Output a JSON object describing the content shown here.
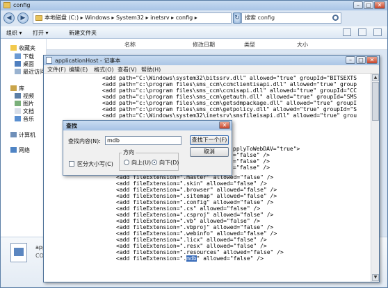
{
  "explorer": {
    "title": "config",
    "address": "本地磁盘 (C:) ▸ Windows ▸ System32 ▸ inetsrv ▸ config ▸",
    "search_placeholder": "搜索 config",
    "toolbar": {
      "organize": "组织 ▾",
      "open": "打开 ▾",
      "new_folder": "新建文件夹"
    },
    "columns": {
      "name": "名称",
      "date": "修改日期",
      "type": "类型",
      "size": "大小"
    },
    "nav": {
      "favorites": "收藏夹",
      "downloads": "下载",
      "desktop": "桌面",
      "recent": "最近访问",
      "libraries": "库",
      "videos": "视频",
      "pictures": "图片",
      "documents": "文档",
      "music": "音乐",
      "computer": "计算机",
      "network": "网络"
    },
    "details": {
      "name": "app",
      "type": "CON"
    }
  },
  "notepad": {
    "title": "applicationHost - 记事本",
    "menus": [
      "文件(F)",
      "编辑(E)",
      "格式(O)",
      "查看(V)",
      "帮助(H)"
    ],
    "lines_top": [
      "<add path=\"C:\\Windows\\system32\\bitssrv.dll\" allowed=\"true\" groupId=\"BITSEXTS",
      "<add path=\"c:\\program files\\sms_ccm\\ccmclientisapi.dll\" allowed=\"true\" group",
      "<add path=\"c:\\program files\\sms_ccm\\ccmisapi.dll\" allowed=\"true\" groupId=\"CC",
      "<add path=\"c:\\program files\\sms_ccm\\getauth.dll\" allowed=\"true\" groupId=\"SMS",
      "<add path=\"c:\\program files\\sms_ccm\\getsdmpackage.dll\" allowed=\"true\" groupI",
      "<add path=\"c:\\program files\\sms_ccm\\getpolicy.dll\" allowed=\"true\" groupId=\"S",
      "<add path=\"C:\\Windows\\system32\\inetsrv\\smsfileisapi.dll\" allowed=\"true\" grou"
    ],
    "line_applytowebdav": "pplyToWebDAV=\"true\">",
    "partial_lines": [
      "=\"false\" />",
      "=\"false\" />",
      "=\"false\" />"
    ],
    "lines_bottom": [
      "<add fileExtension=\".master\" allowed=\"false\" />",
      "<add fileExtension=\".skin\" allowed=\"false\" />",
      "<add fileExtension=\".browser\" allowed=\"false\" />",
      "<add fileExtension=\".sitemap\" allowed=\"false\" />",
      "<add fileExtension=\".config\" allowed=\"false\" />",
      "<add fileExtension=\".cs\" allowed=\"false\" />",
      "<add fileExtension=\".csproj\" allowed=\"false\" />",
      "<add fileExtension=\".vb\" allowed=\"false\" />",
      "<add fileExtension=\".vbproj\" allowed=\"false\" />",
      "<add fileExtension=\".webinfo\" allowed=\"false\" />",
      "<add fileExtension=\".licx\" allowed=\"false\" />",
      "<add fileExtension=\".resx\" allowed=\"false\" />",
      "<add fileExtension=\".resources\" allowed=\"false\" />"
    ],
    "last_line": {
      "before": "<add fileExtension=\".",
      "highlight": "mdb",
      "after": "\" allowed=\"false\" />"
    }
  },
  "find_dialog": {
    "title": "查找",
    "find_label": "查找内容(N):",
    "find_value": "mdb",
    "find_next": "查找下一个(F)",
    "cancel": "取消",
    "direction_label": "方向",
    "up": "向上(U)",
    "down": "向下(D)",
    "match_case": "区分大小写(C)",
    "selected_direction": "down"
  },
  "colors": {
    "accent": "#3569b8",
    "titlebar": "#aac5e5"
  }
}
